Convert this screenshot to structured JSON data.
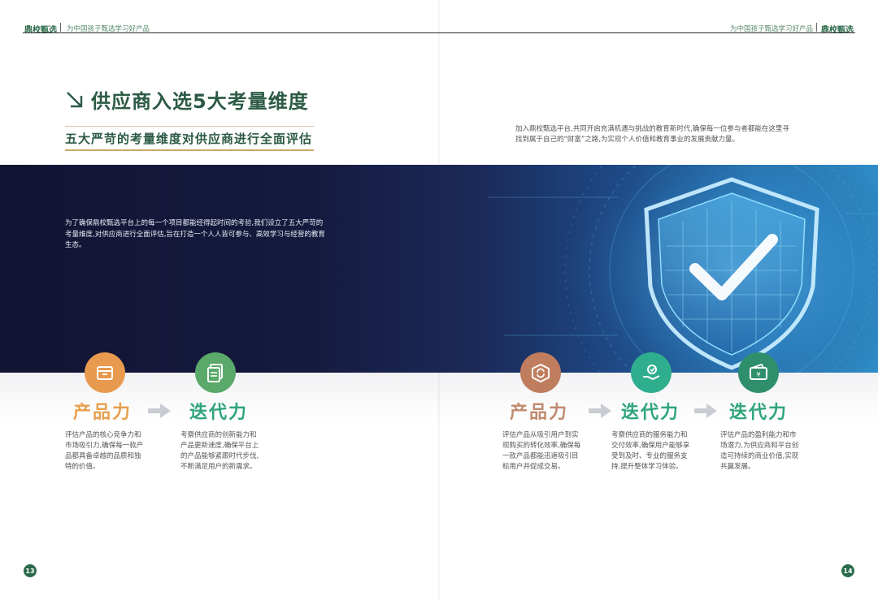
{
  "header": {
    "brand": "鼎校甄选",
    "slogan": "为中国孩子甄选学习好产品"
  },
  "title": "供应商入选5大考量维度",
  "subtitle": "五大严苛的考量维度对供应商进行全面评估",
  "intro_right": "加入鼎校甄选平台,共同开启充满机遇与挑战的教育新时代,确保每一位参与者都能在这里寻找到属于自己的“财富”之路,为实现个人价值和教育事业的发展贡献力量。",
  "banner_text": "为了确保鼎校甄选平台上的每一个项目都能经得起时间的考验,我们设立了五大严苛的考量维度,对供应商进行全面评估,旨在打造一个人人皆可参与、高效学习与经营的教育生态。",
  "dimensions": [
    {
      "label": "产品力",
      "icon": "box-icon",
      "color": "#e89a4e",
      "desc": "评估产品的核心竞争力和市场吸引力,确保每一款产品都具备卓越的品质和独特的价值。"
    },
    {
      "label": "迭代力",
      "icon": "documents-icon",
      "color": "#5aa86a",
      "desc": "考察供应商的创新能力和产品更新速度,确保平台上的产品能够紧跟时代步伐,不断满足用户的新需求。"
    },
    {
      "label": "产品力",
      "icon": "recycle-box-icon",
      "color": "#c07d5e",
      "desc": "评估产品从吸引用户到实现购买的转化效率,确保每一款产品都能迅速吸引目标用户并促成交易。"
    },
    {
      "label": "迭代力",
      "icon": "hand-service-icon",
      "color": "#2fae8e",
      "desc": "考察供应商的服务能力和交付效率,确保用户能够享受到及时、专业的服务支持,提升整体学习体验。"
    },
    {
      "label": "迭代力",
      "icon": "wallet-icon",
      "color": "#2f8f6c",
      "desc": "评估产品的盈利能力和市场潜力,为供应商和平台创造可持续的商业价值,实现共赢发展。"
    }
  ],
  "page_numbers": {
    "left": "13",
    "right": "14"
  },
  "colors": {
    "brand_green": "#2c5a45",
    "gold": "#c9a86a",
    "banner_dark": "#121433",
    "banner_blue": "#2f8cc7"
  }
}
